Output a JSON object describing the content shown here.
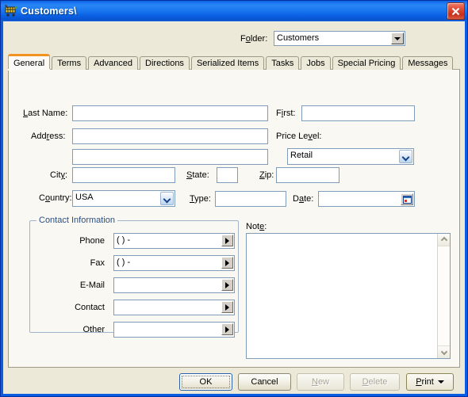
{
  "window": {
    "title": "Customers\\",
    "icon": "shopping-cart-icon",
    "close_label": "×",
    "frame_color": "#0a5ce0",
    "client_bg": "#ece9d8"
  },
  "folder": {
    "label_pre": "F",
    "label_accel": "o",
    "label_post": "lder:",
    "value": "Customers",
    "options": [
      "Customers"
    ]
  },
  "tabs": [
    {
      "label": "General",
      "active": true
    },
    {
      "label": "Terms",
      "active": false
    },
    {
      "label": "Advanced",
      "active": false
    },
    {
      "label": "Directions",
      "active": false
    },
    {
      "label": "Serialized Items",
      "active": false
    },
    {
      "label": "Tasks",
      "active": false
    },
    {
      "label": "Jobs",
      "active": false
    },
    {
      "label": "Special Pricing",
      "active": false
    },
    {
      "label": "Messages",
      "active": false
    }
  ],
  "active_tab_accent": "#f29321",
  "form": {
    "last_name": {
      "label_pre": "",
      "label_accel": "L",
      "label_post": "ast Name:",
      "value": ""
    },
    "first": {
      "label_pre": "F",
      "label_accel": "i",
      "label_post": "rst:",
      "value": ""
    },
    "address": {
      "label_pre": "Add",
      "label_accel": "r",
      "label_post": "ess:",
      "value": ""
    },
    "address2": {
      "value": ""
    },
    "price_level": {
      "label_pre": "Price Le",
      "label_accel": "v",
      "label_post": "el:",
      "value": "Retail",
      "options": [
        "Retail"
      ]
    },
    "city": {
      "label_pre": "Cit",
      "label_accel": "y",
      "label_post": ":",
      "value": ""
    },
    "state": {
      "label_pre": "",
      "label_accel": "S",
      "label_post": "tate:",
      "value": ""
    },
    "zip": {
      "label_pre": "",
      "label_accel": "Z",
      "label_post": "ip:",
      "value": ""
    },
    "country": {
      "label_pre": "C",
      "label_accel": "o",
      "label_post": "untry:",
      "value": "USA",
      "options": [
        "USA"
      ]
    },
    "type": {
      "label_pre": "",
      "label_accel": "T",
      "label_post": "ype:",
      "value": ""
    },
    "date": {
      "label_pre": "D",
      "label_accel": "a",
      "label_post": "te:",
      "value": ""
    }
  },
  "contact_group": {
    "title": "Contact Information",
    "title_color": "#2a4f86",
    "rows": [
      {
        "label": "Phone",
        "value": "(   )    -"
      },
      {
        "label": "Fax",
        "value": "(   )    -"
      },
      {
        "label": "E-Mail",
        "value": ""
      },
      {
        "label": "Contact",
        "value": ""
      },
      {
        "label": "Other",
        "value": ""
      }
    ]
  },
  "note": {
    "label_pre": "Not",
    "label_accel": "e",
    "label_post": ":",
    "value": "",
    "scrollbar": true
  },
  "buttons": [
    {
      "label": "OK",
      "state": "default"
    },
    {
      "label": "Cancel",
      "state": "normal"
    },
    {
      "label": "New",
      "state": "disabled",
      "accel": "N"
    },
    {
      "label": "Delete",
      "state": "disabled",
      "accel": "D"
    },
    {
      "label": "Print",
      "state": "split",
      "accel": "P"
    }
  ]
}
